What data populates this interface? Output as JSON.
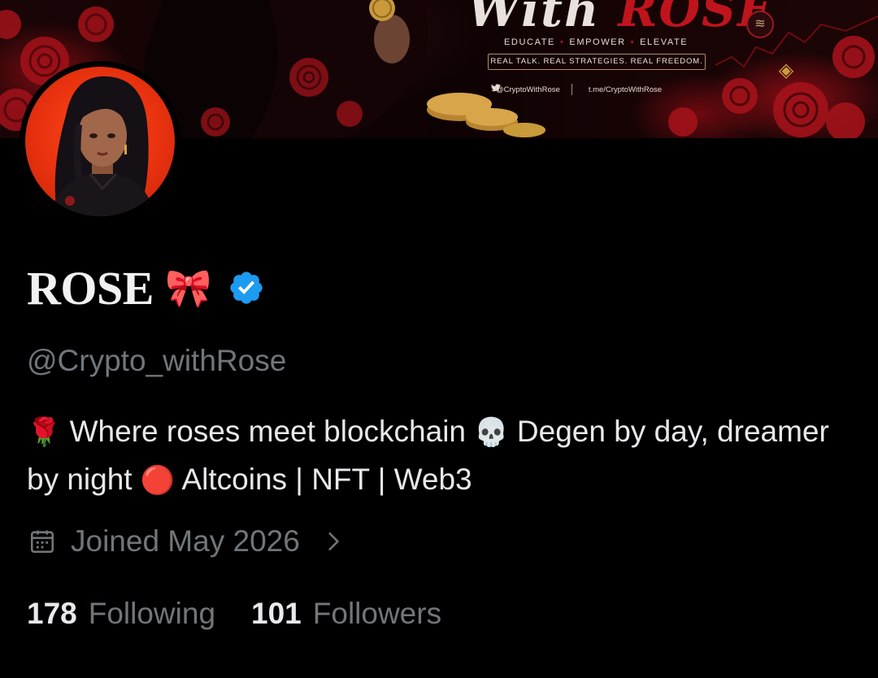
{
  "banner": {
    "title_part1": "With",
    "title_part2": "ROSE",
    "tagline_items": [
      "EDUCATE",
      "EMPOWER",
      "ELEVATE"
    ],
    "boxed_text": "REAL TALK. REAL STRATEGIES. REAL FREEDOM.",
    "twitter_handle": "@CryptoWithRose",
    "telegram_link": "t.me/CryptoWithRose",
    "watermark_text": "ROSE"
  },
  "profile": {
    "display_name": "ROSE",
    "name_emoji": "🎀",
    "verified": true,
    "handle": "@Crypto_withRose",
    "bio": {
      "rose_emoji": "🌹",
      "text1": "Where roses meet blockchain",
      "skull_emoji": "💀",
      "text2": "Degen by day, dreamer by night",
      "circle_emoji": "🔴",
      "text3": "Altcoins | NFT | Web3"
    },
    "joined": "Joined May 2026",
    "following_count": "178",
    "following_label": "Following",
    "followers_count": "101",
    "followers_label": "Followers"
  },
  "colors": {
    "background": "#000000",
    "primary_text": "#e7e9ea",
    "secondary_text": "#71767b",
    "verified_blue": "#1d9bf0",
    "accent_red": "#c0141c"
  }
}
